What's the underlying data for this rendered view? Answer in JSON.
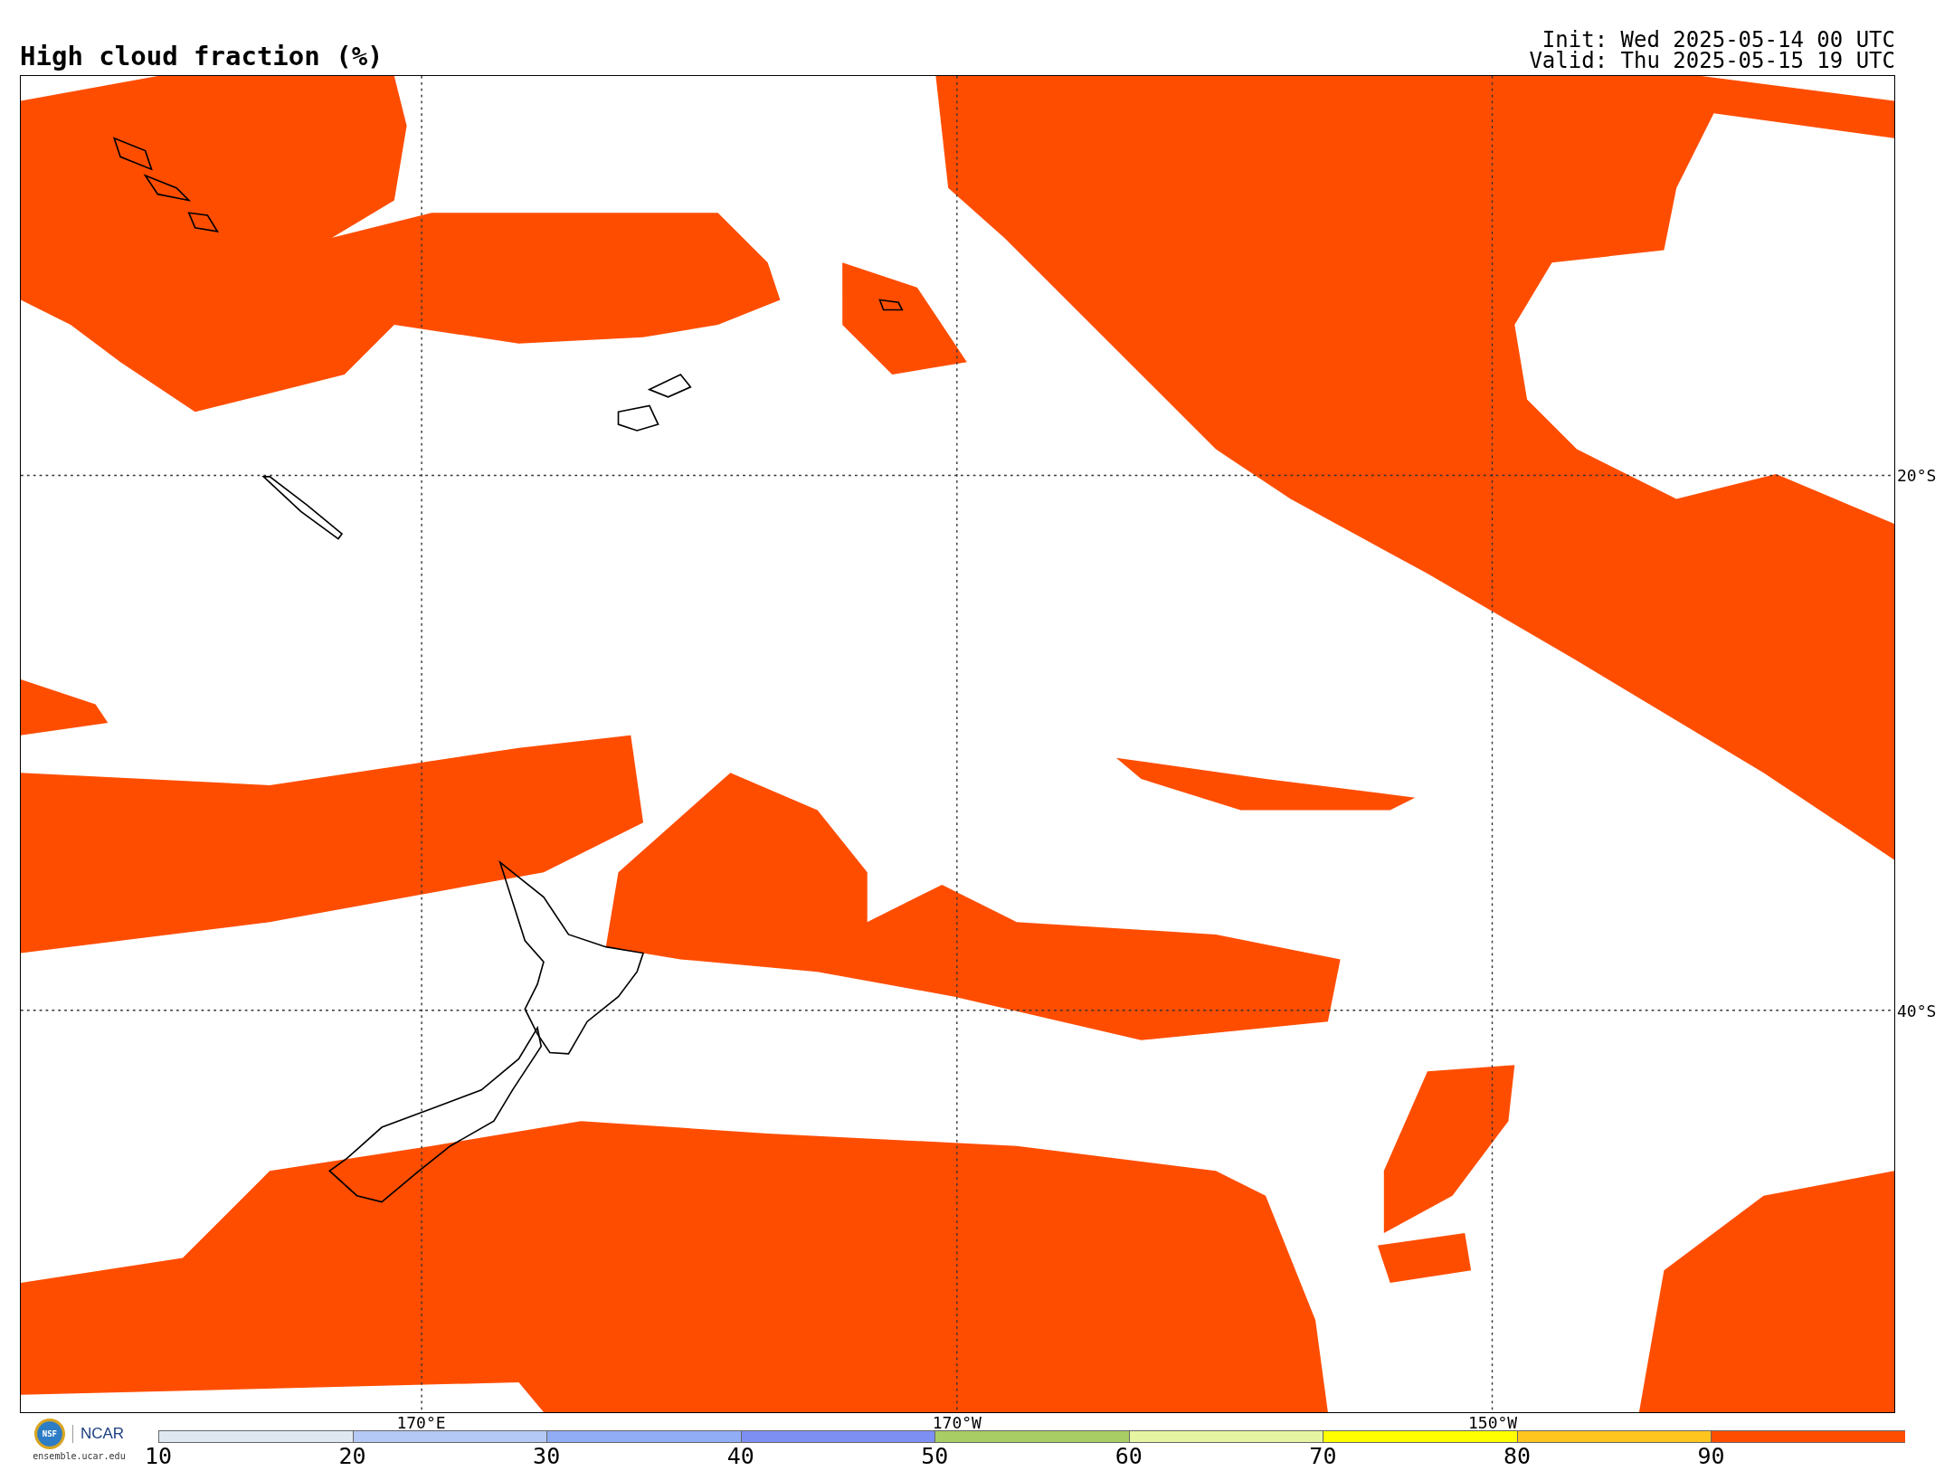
{
  "title": "High cloud fraction (%)",
  "run_info": [
    "Init: Wed 2025-05-14 00 UTC",
    "Valid: Thu 2025-05-15 19 UTC"
  ],
  "map": {
    "lat_labels": [
      "20°S",
      "40°S"
    ],
    "lon_labels": [
      "170°E",
      "170°W",
      "150°W"
    ]
  },
  "logos": {
    "left": "NSF",
    "right": "NCAR",
    "site": "ensemble.ucar.edu"
  },
  "colorbar": [
    {
      "label": "10",
      "color": "#dfe8f1"
    },
    {
      "label": "20",
      "color": "#b5c9f6"
    },
    {
      "label": "30",
      "color": "#90adf5"
    },
    {
      "label": "40",
      "color": "#7d8ff2"
    },
    {
      "label": "50",
      "color": "#a8cd64"
    },
    {
      "label": "60",
      "color": "#e5f5a2"
    },
    {
      "label": "70",
      "color": "#ffff00"
    },
    {
      "label": "80",
      "color": "#ffc51f"
    },
    {
      "label": "90",
      "color": "#ff4d00"
    }
  ]
}
